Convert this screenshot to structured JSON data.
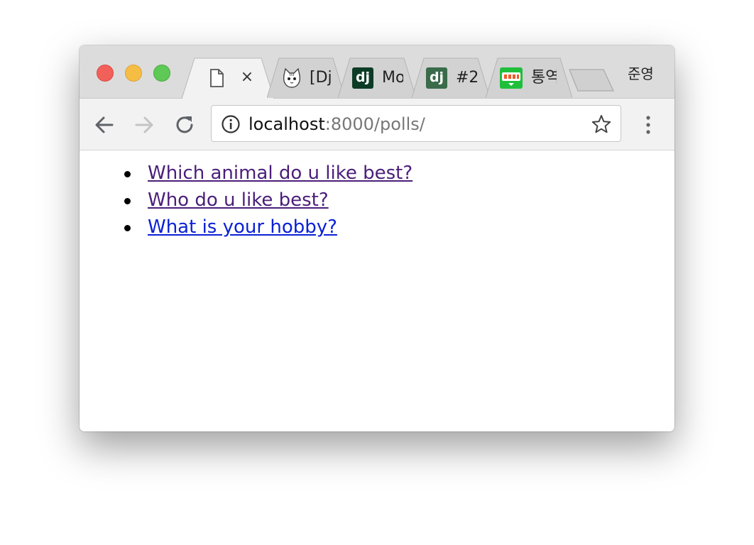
{
  "window": {
    "controls": [
      "close",
      "minimize",
      "zoom"
    ]
  },
  "tabs": [
    {
      "title": "",
      "favicon": "page-icon",
      "active": true,
      "close_glyph": "×"
    },
    {
      "title": "[Dj",
      "favicon": "cat-icon",
      "active": false
    },
    {
      "title": "Mo",
      "favicon": "django-icon",
      "favicon_text": "dj",
      "active": false
    },
    {
      "title": "#2",
      "favicon": "django-icon",
      "favicon_text": "dj",
      "active": false
    },
    {
      "title": "통역",
      "favicon": "blog-icon",
      "active": false
    }
  ],
  "profile": {
    "name": "준영"
  },
  "toolbar": {
    "url_host": "localhost",
    "url_rest": ":8000/polls/"
  },
  "content": {
    "poll_links": [
      {
        "text": "Which animal do u like best?",
        "visited": true
      },
      {
        "text": "Who do u like best?",
        "visited": true
      },
      {
        "text": "What is your hobby?",
        "visited": false
      }
    ]
  },
  "colors": {
    "visited_link": "#4b1e7a",
    "link": "#0a20d6",
    "titlebar": "#dcdcdc",
    "toolbar": "#f2f2f2"
  }
}
